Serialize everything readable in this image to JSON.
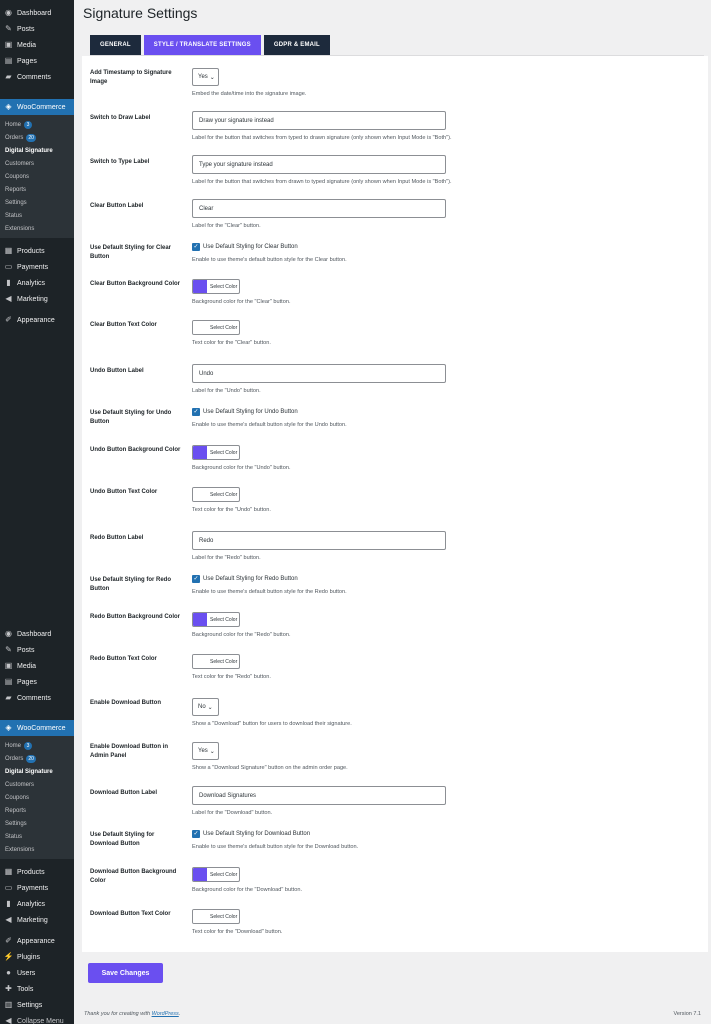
{
  "sidebar": {
    "block1": {
      "top_items": [
        {
          "label": "Dashboard",
          "icon": "dashboard-icon",
          "glyph": "◉"
        },
        {
          "label": "Posts",
          "icon": "pin-icon",
          "glyph": "✎"
        },
        {
          "label": "Media",
          "icon": "media-icon",
          "glyph": "▣"
        },
        {
          "label": "Pages",
          "icon": "pages-icon",
          "glyph": "▤"
        },
        {
          "label": "Comments",
          "icon": "comments-icon",
          "glyph": "▰"
        }
      ],
      "woocommerce": {
        "label": "WooCommerce",
        "icon": "woocommerce-icon",
        "glyph": "◈"
      },
      "sub_items": [
        {
          "label": "Home",
          "badge": "3"
        },
        {
          "label": "Orders",
          "badge": "20"
        },
        {
          "label": "Digital Signature",
          "badge": "",
          "current": true
        },
        {
          "label": "Customers",
          "badge": ""
        },
        {
          "label": "Coupons",
          "badge": ""
        },
        {
          "label": "Reports",
          "badge": ""
        },
        {
          "label": "Settings",
          "badge": ""
        },
        {
          "label": "Status",
          "badge": ""
        },
        {
          "label": "Extensions",
          "badge": ""
        }
      ],
      "bottom_items": [
        {
          "label": "Products",
          "icon": "products-icon",
          "glyph": "▦"
        },
        {
          "label": "Payments",
          "icon": "payments-icon",
          "glyph": "▭"
        },
        {
          "label": "Analytics",
          "icon": "analytics-icon",
          "glyph": "▮"
        },
        {
          "label": "Marketing",
          "icon": "marketing-icon",
          "glyph": "◀"
        }
      ],
      "appearance": {
        "label": "Appearance",
        "icon": "appearance-icon",
        "glyph": "✐"
      }
    },
    "block2": {
      "top_items": [
        {
          "label": "Dashboard",
          "icon": "dashboard-icon",
          "glyph": "◉"
        },
        {
          "label": "Posts",
          "icon": "pin-icon",
          "glyph": "✎"
        },
        {
          "label": "Media",
          "icon": "media-icon",
          "glyph": "▣"
        },
        {
          "label": "Pages",
          "icon": "pages-icon",
          "glyph": "▤"
        },
        {
          "label": "Comments",
          "icon": "comments-icon",
          "glyph": "▰"
        }
      ],
      "woocommerce": {
        "label": "WooCommerce",
        "icon": "woocommerce-icon",
        "glyph": "◈"
      },
      "sub_items": [
        {
          "label": "Home",
          "badge": "3"
        },
        {
          "label": "Orders",
          "badge": "20"
        },
        {
          "label": "Digital Signature",
          "badge": "",
          "current": true
        },
        {
          "label": "Customers",
          "badge": ""
        },
        {
          "label": "Coupons",
          "badge": ""
        },
        {
          "label": "Reports",
          "badge": ""
        },
        {
          "label": "Settings",
          "badge": ""
        },
        {
          "label": "Status",
          "badge": ""
        },
        {
          "label": "Extensions",
          "badge": ""
        }
      ],
      "bottom_items": [
        {
          "label": "Products",
          "icon": "products-icon",
          "glyph": "▦"
        },
        {
          "label": "Payments",
          "icon": "payments-icon",
          "glyph": "▭"
        },
        {
          "label": "Analytics",
          "icon": "analytics-icon",
          "glyph": "▮"
        },
        {
          "label": "Marketing",
          "icon": "marketing-icon",
          "glyph": "◀"
        }
      ],
      "extra_items": [
        {
          "label": "Appearance",
          "icon": "appearance-icon",
          "glyph": "✐"
        },
        {
          "label": "Plugins",
          "icon": "plugins-icon",
          "glyph": "⚡"
        },
        {
          "label": "Users",
          "icon": "users-icon",
          "glyph": "●"
        },
        {
          "label": "Tools",
          "icon": "tools-icon",
          "glyph": "✚"
        },
        {
          "label": "Settings",
          "icon": "settings-icon",
          "glyph": "▥"
        },
        {
          "label": "Collapse Menu",
          "icon": "collapse-icon",
          "glyph": "◀"
        }
      ]
    }
  },
  "page": {
    "title": "Signature Settings",
    "tabs": [
      {
        "label": "GENERAL",
        "active": false
      },
      {
        "label": "STYLE / TRANSLATE SETTINGS",
        "active": true
      },
      {
        "label": "GDPR & EMAIL",
        "active": false
      }
    ]
  },
  "settings": [
    {
      "label": "Add Timestamp to Signature Image",
      "type": "select",
      "value": "Yes",
      "desc": "Embed the date/time into the signature image."
    },
    {
      "label": "Switch to Draw Label",
      "type": "text",
      "value": "Draw your signature instead",
      "desc": "Label for the button that switches from typed to drawn signature (only shown when Input Mode is \"Both\")."
    },
    {
      "label": "Switch to Type Label",
      "type": "text",
      "value": "Type your signature instead",
      "desc": "Label for the button that switches from drawn to typed signature (only shown when Input Mode is \"Both\")."
    },
    {
      "label": "Clear Button Label",
      "type": "text",
      "value": "Clear",
      "desc": "Label for the \"Clear\" button."
    },
    {
      "label": "Use Default Styling for Clear Button",
      "type": "checkbox",
      "value": "Use Default Styling for Clear Button",
      "desc": "Enable to use theme's default button style for the Clear button."
    },
    {
      "label": "Clear Button Background Color",
      "type": "color",
      "value": "Select Color",
      "color": "#6a4ff0",
      "desc": "Background color for the \"Clear\" button."
    },
    {
      "label": "Clear Button Text Color",
      "type": "color",
      "value": "Select Color",
      "color": "#ffffff",
      "desc": "Text color for the \"Clear\" button."
    },
    {
      "label": "Undo Button Label",
      "type": "text",
      "value": "Undo",
      "desc": "Label for the \"Undo\" button."
    },
    {
      "label": "Use Default Styling for Undo Button",
      "type": "checkbox",
      "value": "Use Default Styling for Undo Button",
      "desc": "Enable to use theme's default button style for the Undo button."
    },
    {
      "label": "Undo Button Background Color",
      "type": "color",
      "value": "Select Color",
      "color": "#6a4ff0",
      "desc": "Background color for the \"Undo\" button."
    },
    {
      "label": "Undo Button Text Color",
      "type": "color",
      "value": "Select Color",
      "color": "#ffffff",
      "desc": "Text color for the \"Undo\" button."
    },
    {
      "label": "Redo Button Label",
      "type": "text",
      "value": "Redo",
      "desc": "Label for the \"Redo\" button."
    },
    {
      "label": "Use Default Styling for Redo Button",
      "type": "checkbox",
      "value": "Use Default Styling for Redo Button",
      "desc": "Enable to use theme's default button style for the Redo button."
    },
    {
      "label": "Redo Button Background Color",
      "type": "color",
      "value": "Select Color",
      "color": "#6a4ff0",
      "desc": "Background color for the \"Redo\" button."
    },
    {
      "label": "Redo Button Text Color",
      "type": "color",
      "value": "Select Color",
      "color": "#ffffff",
      "desc": "Text color for the \"Redo\" button."
    },
    {
      "label": "Enable Download Button",
      "type": "select",
      "value": "No",
      "desc": "Show a \"Download\" button for users to download their signature."
    },
    {
      "label": "Enable Download Button in Admin Panel",
      "type": "select",
      "value": "Yes",
      "desc": "Show a \"Download Signature\" button on the admin order page."
    },
    {
      "label": "Download Button Label",
      "type": "text",
      "value": "Download Signatures",
      "desc": "Label for the \"Download\" button."
    },
    {
      "label": "Use Default Styling for Download Button",
      "type": "checkbox",
      "value": "Use Default Styling for Download Button",
      "desc": "Enable to use theme's default button style for the Download button."
    },
    {
      "label": "Download Button Background Color",
      "type": "color",
      "value": "Select Color",
      "color": "#6a4ff0",
      "desc": "Background color for the \"Download\" button."
    },
    {
      "label": "Download Button Text Color",
      "type": "color",
      "value": "Select Color",
      "color": "#ffffff",
      "desc": "Text color for the \"Download\" button."
    }
  ],
  "save_label": "Save Changes",
  "footer": {
    "thanks_prefix": "Thank you for creating with ",
    "wordpress_link": "WordPress",
    "thanks_suffix": ".",
    "version": "Version 7.1"
  },
  "colors": {
    "accent": "#6a4ff0",
    "sidebar_bg": "#1d2327",
    "active_menu": "#2271b1",
    "tab_dark": "#1d2a3c"
  }
}
